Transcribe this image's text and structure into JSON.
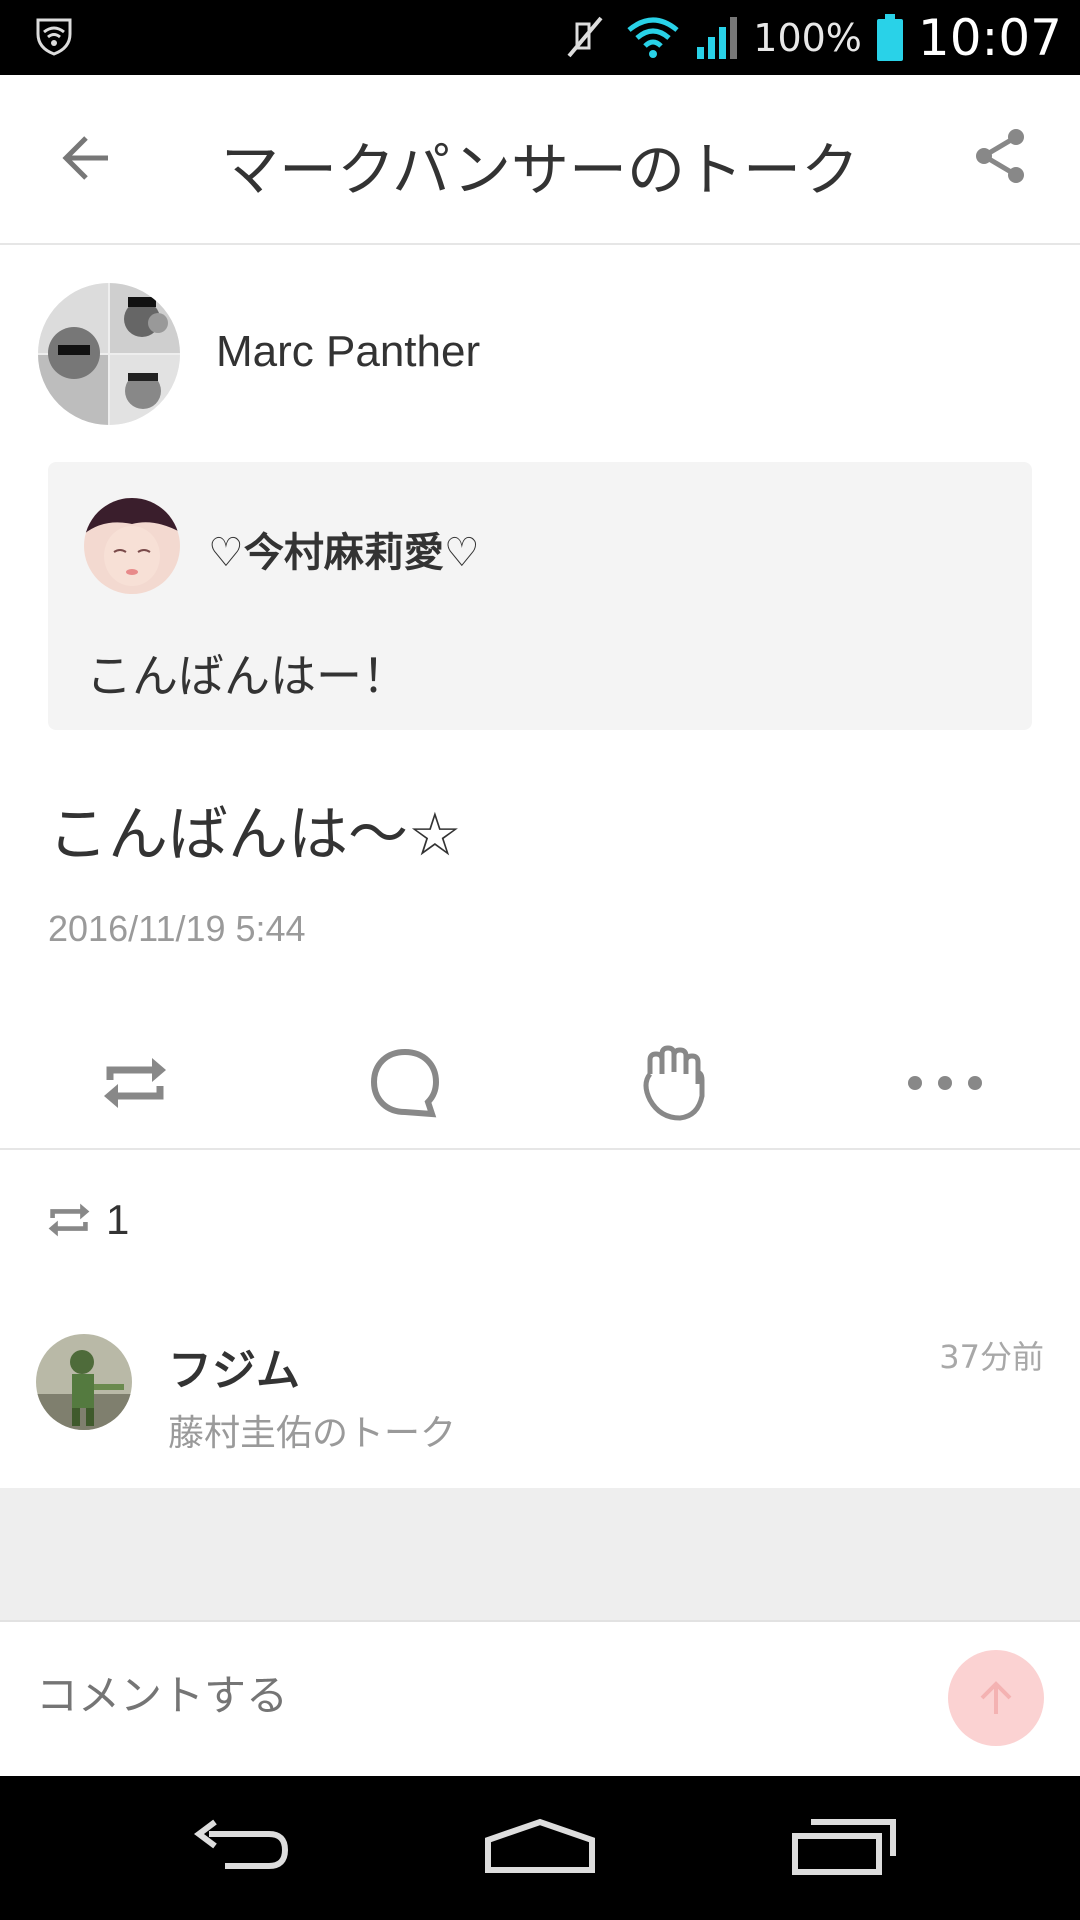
{
  "status_bar": {
    "battery_text": "100%",
    "time": "10:07",
    "accent_color": "#29d2e8"
  },
  "header": {
    "title": "マークパンサーのトーク"
  },
  "author": {
    "name": "Marc Panther"
  },
  "quoted_post": {
    "name": "♡今村麻莉愛♡",
    "text": "こんばんはー！"
  },
  "post": {
    "text": "こんばんは～☆",
    "timestamp": "2016/11/19 5:44"
  },
  "actions": {
    "icons": [
      "repost-icon",
      "comment-icon",
      "clap-icon",
      "more-icon"
    ]
  },
  "reposts": {
    "count": "1"
  },
  "reposters": [
    {
      "name": "フジム",
      "subtitle": "藤村圭佑のトーク",
      "time": "37分前"
    }
  ],
  "comment": {
    "placeholder": "コメントする",
    "send_color": "#fbd2d2"
  }
}
